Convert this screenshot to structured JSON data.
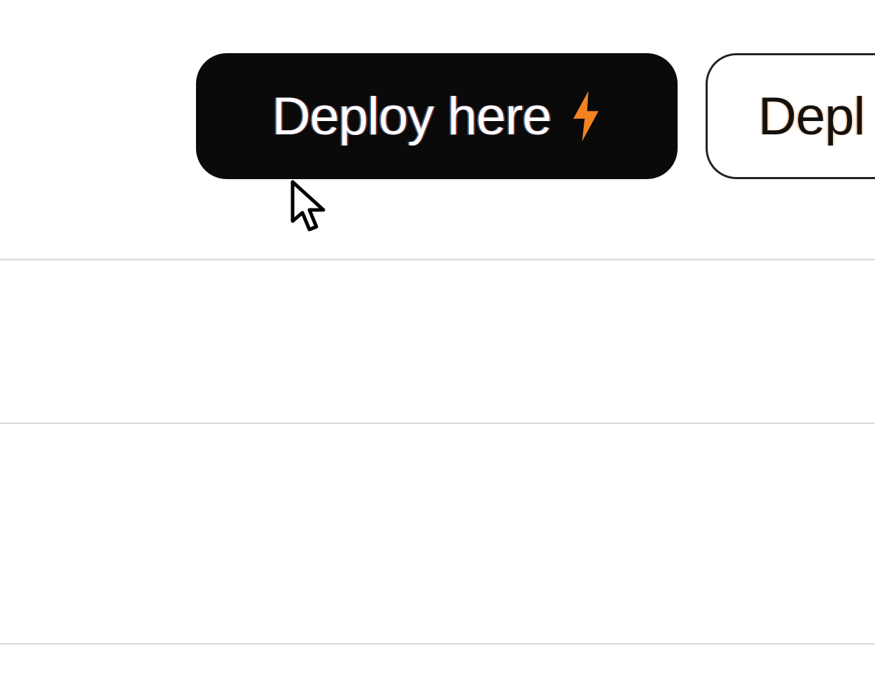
{
  "buttons": {
    "primary": {
      "label": "Deploy here",
      "icon": "lightning"
    },
    "secondary": {
      "label_visible": "Depl"
    }
  },
  "colors": {
    "buttonPrimaryBg": "#0a0a0a",
    "buttonPrimaryText": "#ffffff",
    "buttonSecondaryBg": "#ffffff",
    "buttonSecondaryBorder": "#222222",
    "lightning": "#f58220",
    "divider": "#d9d9d9"
  }
}
